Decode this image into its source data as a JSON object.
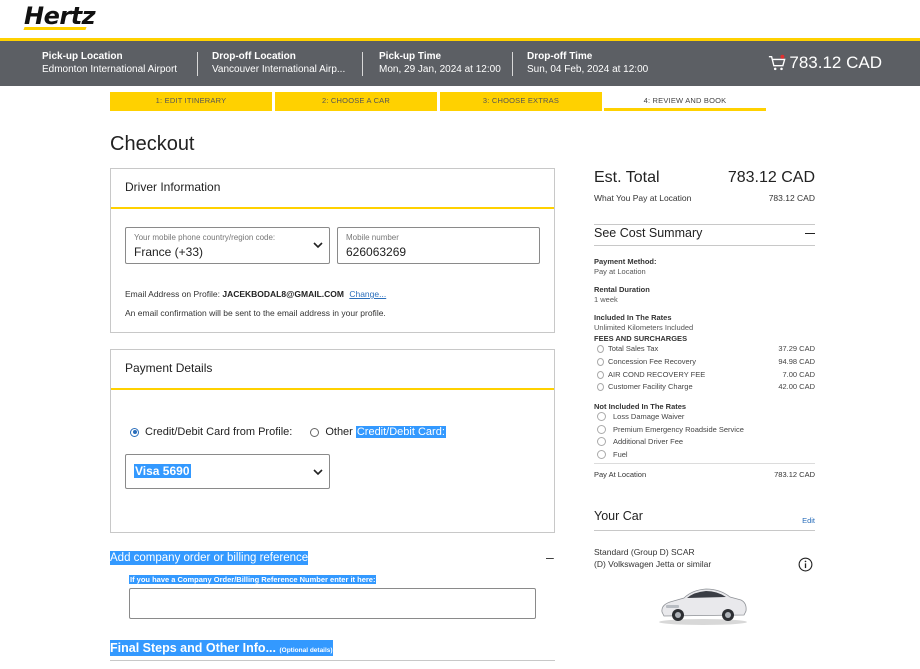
{
  "brand": {
    "logo_text": "Hertz"
  },
  "summary": {
    "pickup_location_label": "Pick-up Location",
    "pickup_location_value": "Edmonton International Airport",
    "dropoff_location_label": "Drop-off Location",
    "dropoff_location_value": "Vancouver International Airp...",
    "pickup_time_label": "Pick-up Time",
    "pickup_time_value": "Mon, 29 Jan, 2024 at 12:00",
    "dropoff_time_label": "Drop-off Time",
    "dropoff_time_value": "Sun, 04 Feb, 2024 at 12:00",
    "cart_total": "783.12 CAD"
  },
  "steps": [
    {
      "label": "1:  EDIT ITINERARY"
    },
    {
      "label": "2:  CHOOSE A CAR"
    },
    {
      "label": "3:  CHOOSE EXTRAS"
    },
    {
      "label": "4:  REVIEW AND BOOK"
    }
  ],
  "page_title": "Checkout",
  "driver": {
    "title": "Driver Information",
    "country_label": "Your mobile phone country/region code:",
    "country_value": "France (+33)",
    "mobile_label": "Mobile number",
    "mobile_value": "626063269",
    "email_prefix": "Email Address on Profile:",
    "email": "JACEKBODAL8@GMAIL.COM",
    "change_link": "Change...",
    "confirmation_note": "An email confirmation will be sent to the email address in your profile."
  },
  "payment": {
    "title": "Payment Details",
    "option_profile": "Credit/Debit Card from Profile:",
    "option_other_prefix": "Other",
    "option_other_hl": "Credit/Debit Card:",
    "selected_card": "Visa 5690"
  },
  "company": {
    "title": "Add company order or billing reference",
    "toggle": "–",
    "note": "If you have a Company Order/Billing Reference Number enter it here:",
    "input_value": ""
  },
  "final_steps": {
    "title": "Final Steps and Other Info...",
    "subtitle": "(Optional details)"
  },
  "sidebar": {
    "est_total_label": "Est. Total",
    "est_total_value": "783.12 CAD",
    "pay_location_label": "What You Pay at Location",
    "pay_location_value": "783.12 CAD",
    "cost_summary_label": "See Cost Summary",
    "payment_method_label": "Payment Method:",
    "payment_method_value": "Pay at Location",
    "rental_duration_label": "Rental Duration",
    "rental_duration_value": "1 week",
    "included_label": "Included In The Rates",
    "included_value": "Unlimited Kilometers Included",
    "fees_label": "FEES AND SURCHARGES",
    "fees": [
      {
        "name": "Total Sales Tax",
        "amount": "37.29 CAD"
      },
      {
        "name": "Concession Fee Recovery",
        "amount": "94.98 CAD"
      },
      {
        "name": "AIR COND RECOVERY FEE",
        "amount": "7.00 CAD"
      },
      {
        "name": "Customer Facility Charge",
        "amount": "42.00 CAD"
      }
    ],
    "not_included_label": "Not Included In The Rates",
    "not_included": [
      {
        "name": "Loss Damage Waiver"
      },
      {
        "name": "Premium Emergency Roadside Service"
      },
      {
        "name": "Additional Driver Fee"
      },
      {
        "name": "Fuel"
      }
    ],
    "pay_at_location_label": "Pay At Location",
    "pay_at_location_value": "783.12 CAD",
    "your_car_label": "Your Car",
    "edit_label": "Edit",
    "car_class": "Standard (Group D) SCAR",
    "car_model": "(D) Volkswagen Jetta or similar"
  },
  "colors": {
    "accent": "#ffd100",
    "bar": "#5c5f64",
    "link": "#2a6ebb",
    "highlight": "#3399ff"
  }
}
